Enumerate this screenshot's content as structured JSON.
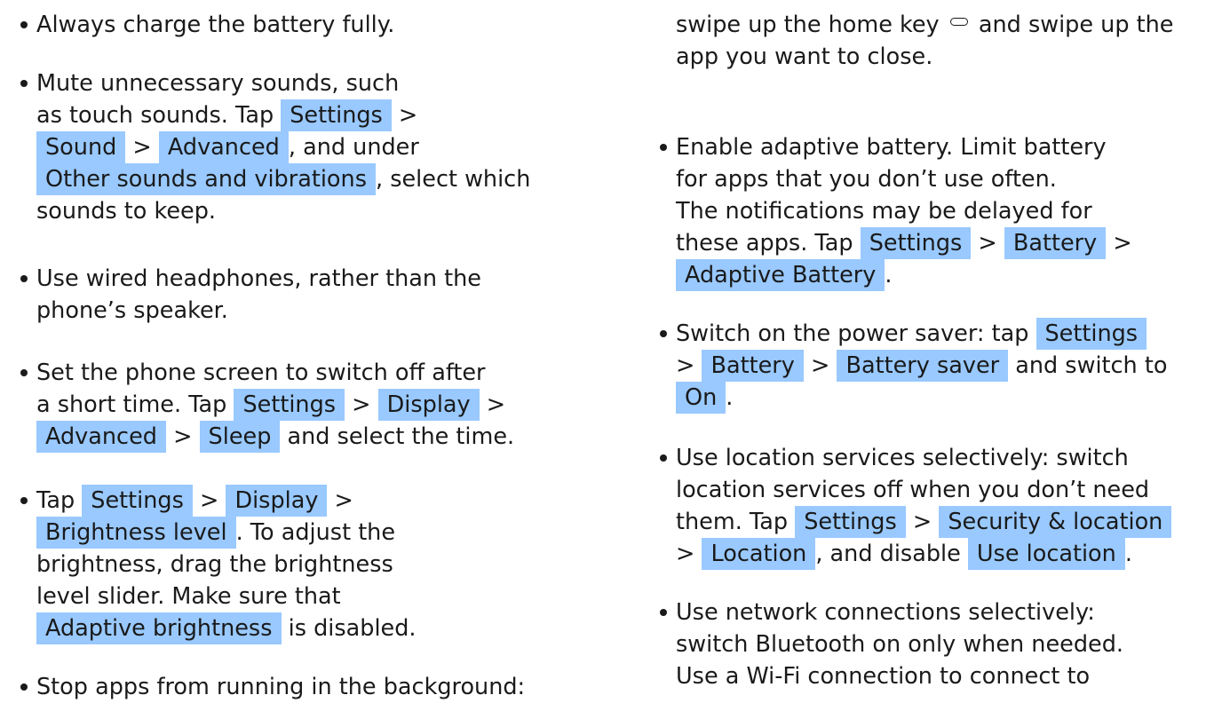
{
  "left_column": {
    "items": [
      {
        "lines": [
          [
            {
              "t": "Always charge the battery fully."
            }
          ]
        ]
      },
      {
        "lines": [
          [
            {
              "t": "Mute unnecessary sounds, such"
            }
          ],
          [
            {
              "t": "as touch sounds. Tap "
            },
            {
              "ui": "Settings"
            },
            {
              "t": " >"
            }
          ],
          [
            {
              "ui": "Sound"
            },
            {
              "t": " > "
            },
            {
              "ui": "Advanced"
            },
            {
              "t": ", and under"
            }
          ],
          [
            {
              "ui": "Other sounds and vibrations"
            },
            {
              "t": ", select which"
            }
          ],
          [
            {
              "t": "sounds to keep."
            }
          ]
        ]
      },
      {
        "lines": [
          [
            {
              "t": "Use wired headphones, rather than the"
            }
          ],
          [
            {
              "t": "phone’s speaker."
            }
          ]
        ]
      },
      {
        "lines": [
          [
            {
              "t": "Set the phone screen to switch off after"
            }
          ],
          [
            {
              "t": "a short time. Tap "
            },
            {
              "ui": "Settings"
            },
            {
              "t": " > "
            },
            {
              "ui": "Display"
            },
            {
              "t": " >"
            }
          ],
          [
            {
              "ui": "Advanced"
            },
            {
              "t": " > "
            },
            {
              "ui": "Sleep"
            },
            {
              "t": " and select the time."
            }
          ]
        ]
      },
      {
        "lines": [
          [
            {
              "t": "Tap "
            },
            {
              "ui": "Settings"
            },
            {
              "t": " > "
            },
            {
              "ui": "Display"
            },
            {
              "t": " >"
            }
          ],
          [
            {
              "ui": "Brightness level"
            },
            {
              "t": ". To adjust the"
            }
          ],
          [
            {
              "t": "brightness, drag the brightness"
            }
          ],
          [
            {
              "t": "level slider. Make sure that"
            }
          ],
          [
            {
              "ui": "Adaptive brightness"
            },
            {
              "t": " is disabled."
            }
          ]
        ]
      },
      {
        "lines": [
          [
            {
              "t": "Stop apps from running in the background:"
            }
          ]
        ]
      }
    ]
  },
  "right_column": {
    "continuation_lines": [
      [
        {
          "t": "swipe up the home key "
        },
        {
          "icon": "home-key-icon"
        },
        {
          "t": " and swipe up the"
        }
      ],
      [
        {
          "t": "app you want to close."
        }
      ]
    ],
    "items": [
      {
        "lines": [
          [
            {
              "t": "Enable adaptive battery. Limit battery"
            }
          ],
          [
            {
              "t": "for apps that you don’t use often."
            }
          ],
          [
            {
              "t": "The notifications may be delayed for"
            }
          ],
          [
            {
              "t": "these apps. Tap "
            },
            {
              "ui": "Settings"
            },
            {
              "t": " > "
            },
            {
              "ui": "Battery"
            },
            {
              "t": " >"
            }
          ],
          [
            {
              "ui": "Adaptive Battery"
            },
            {
              "t": "."
            }
          ]
        ]
      },
      {
        "lines": [
          [
            {
              "t": "Switch on the power saver: tap "
            },
            {
              "ui": "Settings"
            }
          ],
          [
            {
              "t": "> "
            },
            {
              "ui": "Battery"
            },
            {
              "t": " > "
            },
            {
              "ui": "Battery saver"
            },
            {
              "t": " and switch to"
            }
          ],
          [
            {
              "ui": "On"
            },
            {
              "t": "."
            }
          ]
        ]
      },
      {
        "lines": [
          [
            {
              "t": "Use location services selectively: switch"
            }
          ],
          [
            {
              "t": "location services off when you don’t need"
            }
          ],
          [
            {
              "t": "them. Tap "
            },
            {
              "ui": "Settings"
            },
            {
              "t": " > "
            },
            {
              "ui": "Security & location"
            }
          ],
          [
            {
              "t": "> "
            },
            {
              "ui": "Location"
            },
            {
              "t": ", and disable "
            },
            {
              "ui": "Use location"
            },
            {
              "t": "."
            }
          ]
        ]
      },
      {
        "lines": [
          [
            {
              "t": "Use network connections selectively:"
            }
          ],
          [
            {
              "t": "switch Bluetooth on only when needed."
            }
          ],
          [
            {
              "t": "Use a Wi-Fi connection to connect to"
            }
          ]
        ]
      }
    ]
  }
}
